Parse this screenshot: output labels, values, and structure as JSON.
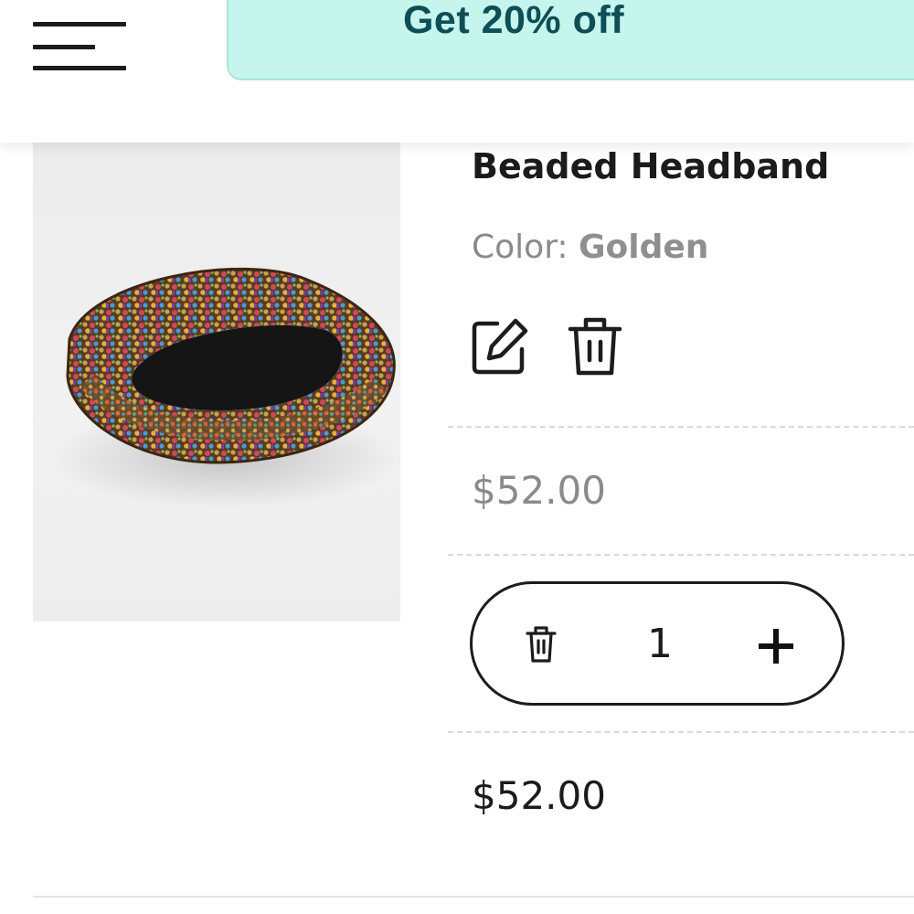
{
  "header": {
    "menu_icon": "hamburger-menu-icon",
    "promo": {
      "text": "Get 20% off",
      "background": "#c5f5ec",
      "text_color": "#0e4e56"
    }
  },
  "cart_item": {
    "title": "Beaded Headband",
    "color_label": "Color:",
    "color_value": "Golden",
    "actions": {
      "edit_icon": "edit-icon",
      "delete_icon": "trash-icon"
    },
    "unit_price": "$52.00",
    "quantity": {
      "remove_icon": "trash-icon",
      "value": "1",
      "add_symbol": "+"
    },
    "line_total": "$52.00"
  }
}
